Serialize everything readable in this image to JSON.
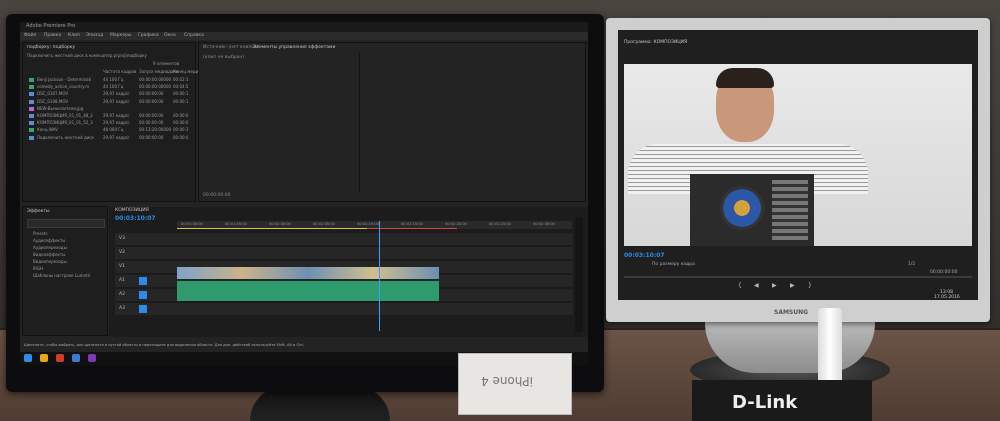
{
  "left_monitor": {
    "app_title": "Adobe Premiere Pro",
    "menu": [
      "Файл",
      "Правка",
      "Клип",
      "Эпизод",
      "Маркеры",
      "Графика",
      "Окно",
      "Справка"
    ],
    "project_panel": {
      "tab": "подборку: подборку",
      "path_line": "Подключить жесткий диск в компьютер.prproj\\подборку",
      "count_label": "9 элементов",
      "columns": [
        "Частота кадров",
        "Запуск медиаданн",
        "Конец медиа"
      ],
      "rows": [
        {
          "name": "Benji Jackson - Determinati",
          "rate": "44 100 Гц",
          "start": "00:00:00:00000",
          "end": "00:02:1"
        },
        {
          "name": "comedy_action_country.m",
          "rate": "44 100 Гц",
          "start": "00:00:00:00000",
          "end": "00:04:5"
        },
        {
          "name": "DSC_0107.MOV",
          "rate": "29,97 кадр/с",
          "start": "00:00:00:00",
          "end": "00:00:1"
        },
        {
          "name": "DSC_0108.MOV",
          "rate": "29,97 кадр/с",
          "start": "00:00:00:00",
          "end": "00:00:1"
        },
        {
          "name": "NEW-Вычислители.jpg",
          "rate": "",
          "start": "",
          "end": ""
        },
        {
          "name": "КОМПОЗИЦИЯ_01_01_48_2",
          "rate": "29,97 кадр/с",
          "start": "00:00:00:00",
          "end": "00:00:0"
        },
        {
          "name": "КОМПОЗИЦИЯ_01_01_52_3",
          "rate": "29,97 кадр/с",
          "start": "00:00:00:00",
          "end": "00:00:0"
        },
        {
          "name": "Конц.WAV",
          "rate": "48 000 Гц",
          "start": "00:13:20:00000",
          "end": "00:00:3"
        },
        {
          "name": "Подключить жесткий диск",
          "rate": "29,97 кадр/с",
          "start": "00:00:00:00",
          "end": "00:00:0"
        }
      ]
    },
    "source_panel": {
      "tabs": [
        "Источник: (нет клипов)",
        "Элементы управления эффектами"
      ],
      "no_clip": "(клип не выбран)",
      "timecode": "00:00:00:00"
    },
    "effects_panel": {
      "tab": "Эффекты",
      "items": [
        "Presets",
        "Аудиоэффекты",
        "Аудиопереходы",
        "Видеоэффекты",
        "Видеопереходы",
        "IRGH",
        "Шаблоны настроек Lumetri"
      ]
    },
    "timeline": {
      "tab": "КОМПОЗИЦИЯ",
      "timecode": "00:03:10:07",
      "ruler": [
        "00:01:50:00",
        "00:01:55:00",
        "00:02:00:00",
        "00:02:05:00",
        "00:02:10:00",
        "00:02:15:00",
        "00:02:20:00",
        "00:02:25:00",
        "00:02:30:00"
      ],
      "tracks": [
        "V3",
        "V2",
        "V1",
        "A1",
        "A2",
        "A3"
      ]
    },
    "taskbar_hint": "Щелкните, чтобы выбрать, или щелкните в пустой области и перетащите для выделения области. Для доп. действий используйте Shift, Alt и Ctrl."
  },
  "right_monitor": {
    "brand": "SAMSUNG",
    "program_tab": "Программа: КОМПОЗИЦИЯ",
    "timecode": "00:03:10:07",
    "fit_label": "По размеру кадра",
    "ratio": "1/2",
    "end_timecode": "00:00:00:00",
    "clock": "13:08",
    "date": "17.05.2016"
  },
  "props": {
    "box_text": "iPhone 4",
    "router_text": "D-Link"
  },
  "colors": {
    "premiere_accent": "#2d8ceb",
    "audio_clip": "#2f9a6e",
    "playhead": "#3aa0ff"
  }
}
